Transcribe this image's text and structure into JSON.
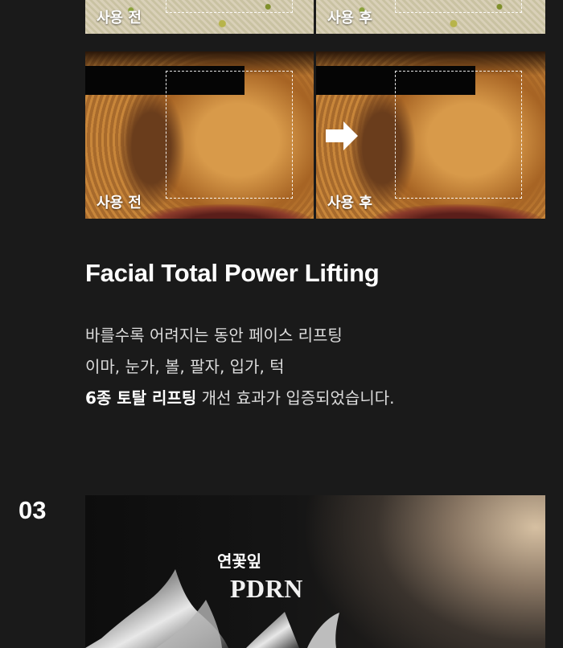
{
  "comparison": {
    "top_row": {
      "before_label": "사용 전",
      "after_label": "사용 후"
    },
    "main_row": {
      "before_label": "사용 전",
      "after_label": "사용 후",
      "arrow_icon": "arrow-right-icon"
    }
  },
  "feature": {
    "heading": "Facial Total Power Lifting",
    "line1": "바를수록 어려지는 동안 페이스 리프팅",
    "line2": "이마, 눈가, 볼, 팔자, 입가, 턱",
    "line3_bold": "6종 토탈 리프팅",
    "line3_rest": " 개선 효과가 입증되었습니다."
  },
  "section": {
    "number": "03",
    "visual_subtitle": "연꽃잎",
    "visual_title": "PDRN"
  }
}
